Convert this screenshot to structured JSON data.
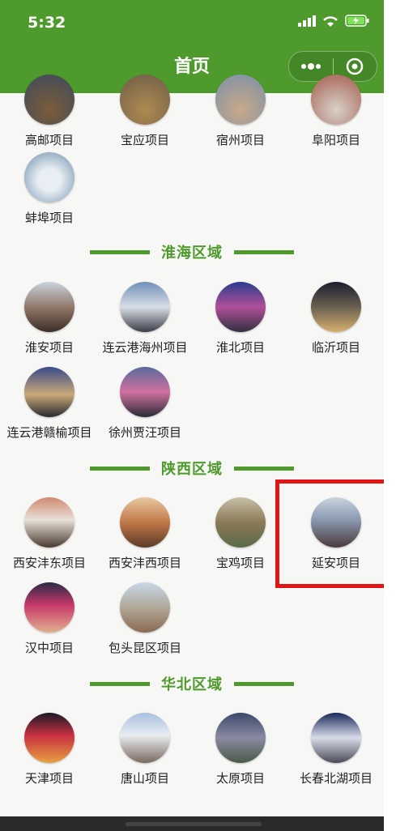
{
  "status": {
    "time": "5:32"
  },
  "header": {
    "title": "首页"
  },
  "rows_top": [
    {
      "label": "高邮项目"
    },
    {
      "label": "宝应项目"
    },
    {
      "label": "宿州项目"
    },
    {
      "label": "阜阳项目"
    }
  ],
  "rows_top2": [
    {
      "label": "蚌埠项目"
    }
  ],
  "sections": [
    {
      "title": "淮海区域",
      "items": [
        {
          "label": "淮安项目"
        },
        {
          "label": "连云港海州项目"
        },
        {
          "label": "淮北项目"
        },
        {
          "label": "临沂项目"
        },
        {
          "label": "连云港赣榆项目"
        },
        {
          "label": "徐州贾汪项目"
        }
      ]
    },
    {
      "title": "陕西区域",
      "items": [
        {
          "label": "西安沣东项目"
        },
        {
          "label": "西安沣西项目"
        },
        {
          "label": "宝鸡项目"
        },
        {
          "label": "延安项目"
        },
        {
          "label": "汉中项目"
        },
        {
          "label": "包头昆区项目"
        }
      ]
    },
    {
      "title": "华北区域",
      "items": [
        {
          "label": "天津项目"
        },
        {
          "label": "唐山项目"
        },
        {
          "label": "太原项目"
        },
        {
          "label": "长春北湖项目"
        }
      ]
    }
  ],
  "colors": {
    "brand": "#4e9a2c",
    "highlight": "#e01515"
  }
}
